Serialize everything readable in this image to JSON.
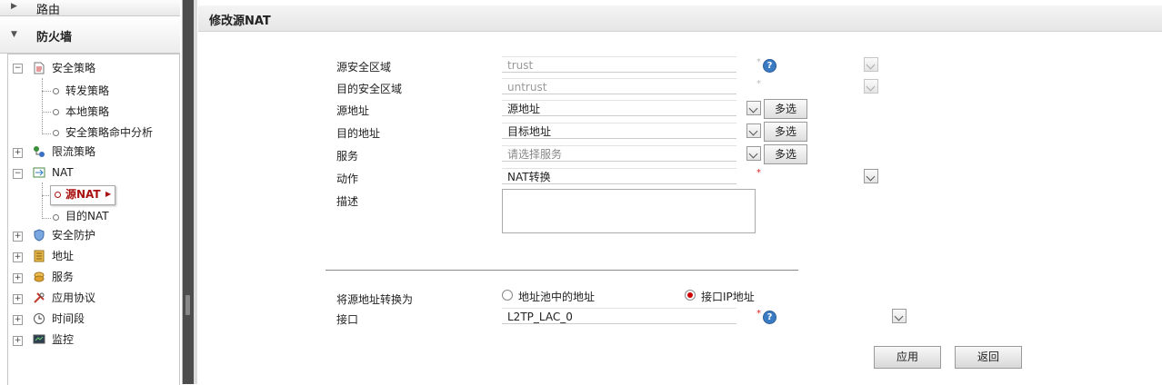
{
  "nav": {
    "routing_label": "路由",
    "firewall_label": "防火墙",
    "tree": {
      "security_policy": "安全策略",
      "forward_policy": "转发策略",
      "local_policy": "本地策略",
      "policy_hit_analysis": "安全策略命中分析",
      "traffic_policy": "限流策略",
      "nat": "NAT",
      "source_nat": "源NAT",
      "dest_nat": "目的NAT",
      "security_protection": "安全防护",
      "address": "地址",
      "service": "服务",
      "app_protocol": "应用协议",
      "time_range": "时间段",
      "monitor": "监控"
    }
  },
  "panel": {
    "title": "修改源NAT"
  },
  "form": {
    "src_zone": {
      "label": "源安全区域",
      "value": "trust"
    },
    "dst_zone": {
      "label": "目的安全区域",
      "value": "untrust"
    },
    "src_addr": {
      "label": "源地址",
      "value": "源地址"
    },
    "dst_addr": {
      "label": "目的地址",
      "value": "目标地址"
    },
    "service": {
      "label": "服务",
      "placeholder": "请选择服务"
    },
    "action": {
      "label": "动作",
      "value": "NAT转换"
    },
    "description": {
      "label": "描述",
      "value": ""
    },
    "multi_select_label": "多选",
    "required_mark": "*",
    "help_mark": "?",
    "translate_to": {
      "label": "将源地址转换为",
      "options": [
        "地址池中的地址",
        "接口IP地址"
      ],
      "selected": "接口IP地址"
    },
    "interface": {
      "label": "接口",
      "value": "L2TP_LAC_0"
    }
  },
  "buttons": {
    "apply": "应用",
    "back": "返回"
  },
  "colors": {
    "required": "#dd2222",
    "selected_text": "#aa1111",
    "help_icon": "#3a7cc4",
    "splitter": "#4d4d4d"
  }
}
